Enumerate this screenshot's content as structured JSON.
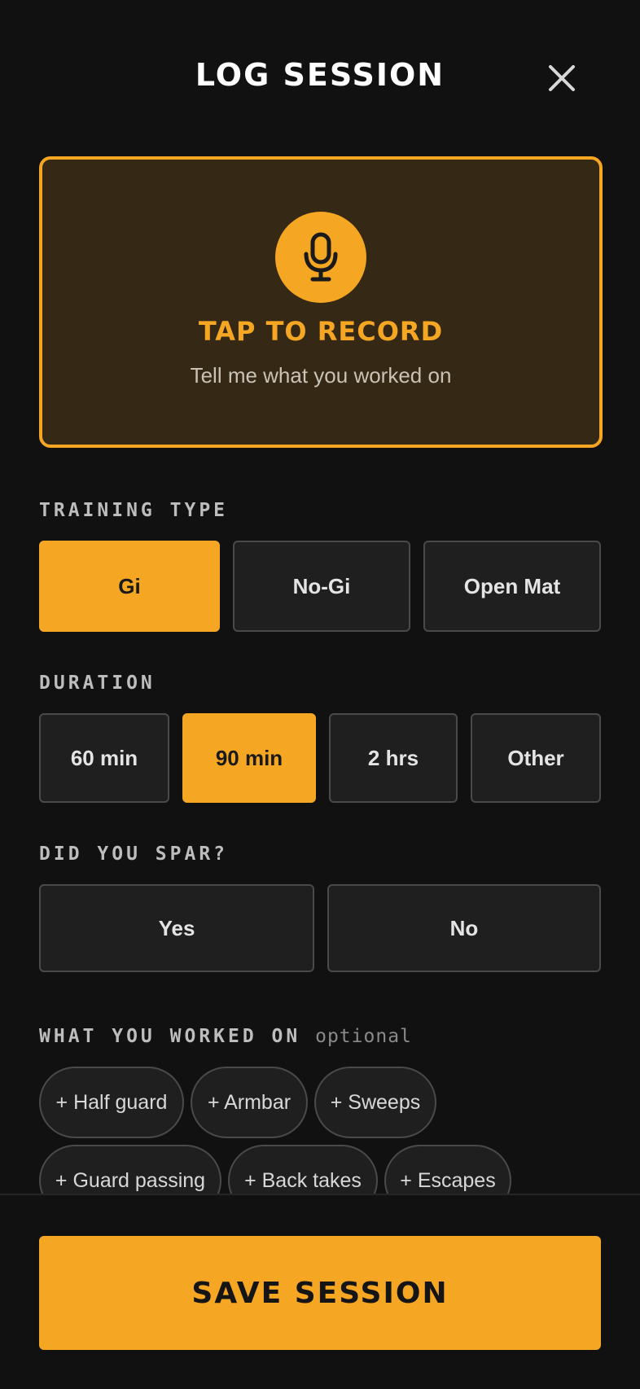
{
  "header": {
    "title": "LOG SESSION",
    "close_icon": "close-icon"
  },
  "record": {
    "icon": "microphone-icon",
    "title": "TAP TO RECORD",
    "subtitle": "Tell me what you worked on"
  },
  "training_type": {
    "label": "TRAINING TYPE",
    "options": [
      "Gi",
      "No-Gi",
      "Open Mat"
    ],
    "selected": "Gi"
  },
  "duration": {
    "label": "DURATION",
    "options": [
      "60 min",
      "90 min",
      "2 hrs",
      "Other"
    ],
    "selected": "90 min"
  },
  "spar": {
    "label": "DID YOU SPAR?",
    "options": [
      "Yes",
      "No"
    ],
    "selected": null
  },
  "worked_on": {
    "label": "WHAT YOU WORKED ON",
    "optional_label": "optional",
    "chips": [
      "+ Half guard",
      "+ Armbar",
      "+ Sweeps",
      "+ Guard passing",
      "+ Back takes",
      "+ Escapes"
    ]
  },
  "footer": {
    "save_label": "SAVE SESSION"
  },
  "colors": {
    "accent": "#f5a623",
    "background": "#111111",
    "card": "#1f1f1f",
    "record_card": "#352814"
  }
}
